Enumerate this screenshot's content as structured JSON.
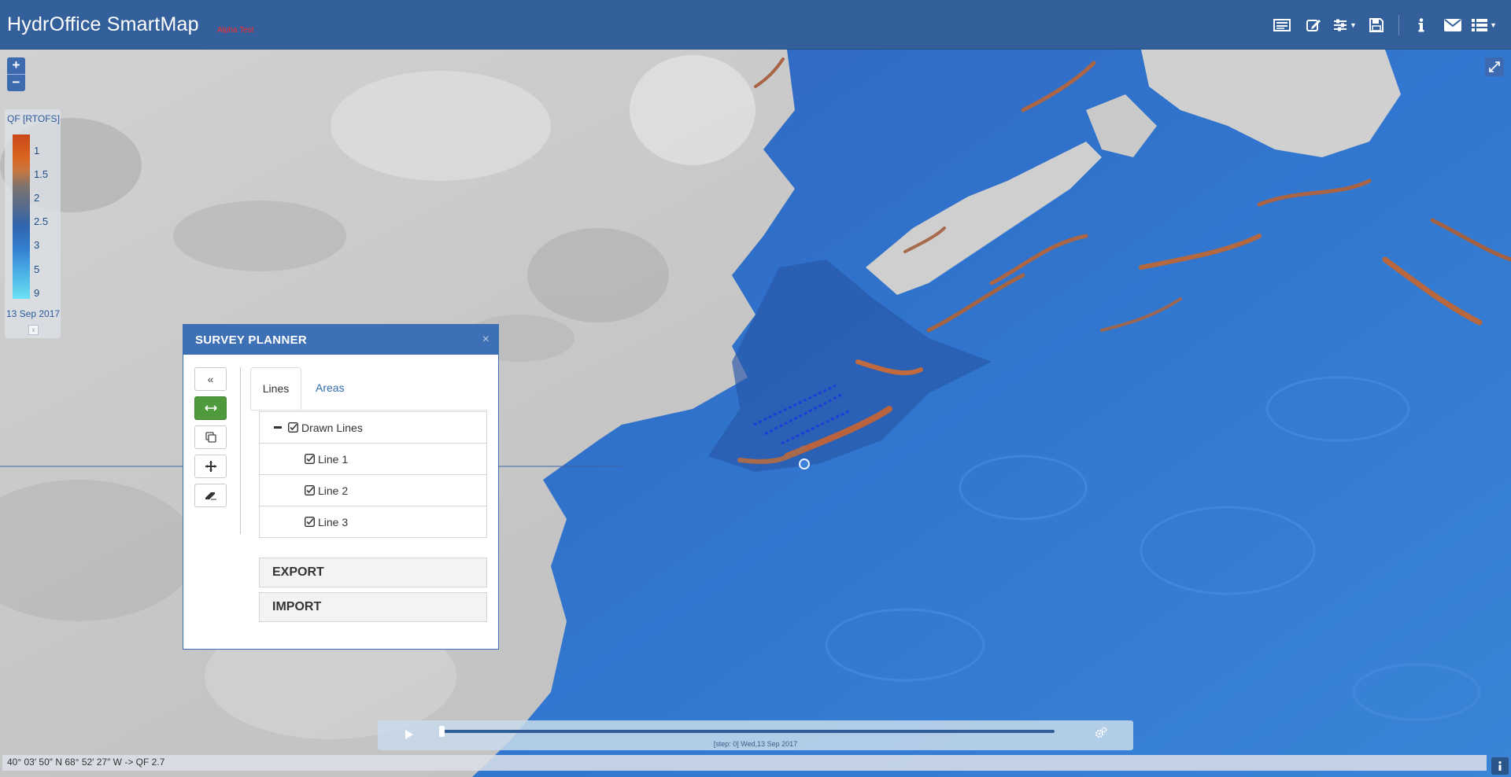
{
  "header": {
    "title": "HydrOffice SmartMap",
    "tag": "Alpha Test",
    "icons": [
      "table-icon",
      "edit-icon",
      "sliders-icon",
      "save-icon",
      "info-icon",
      "envelope-icon",
      "list-icon"
    ]
  },
  "zoom": {
    "in_label": "+",
    "out_label": "−"
  },
  "legend": {
    "title": "QF [RTOFS]",
    "labels": [
      "1",
      "1.5",
      "2",
      "2.5",
      "3",
      "5",
      "9"
    ],
    "date": "13 Sep 2017",
    "close_label": "x",
    "colors": [
      "#c9471a",
      "#d9651e",
      "#7a7370",
      "#2f64aa",
      "#3580d2",
      "#4eb6e7",
      "#6ce1f4"
    ]
  },
  "planner": {
    "title": "SURVEY PLANNER",
    "close_label": "×",
    "tools": [
      "collapse-icon",
      "draw-line-icon",
      "copy-icon",
      "move-icon",
      "eraser-icon"
    ],
    "tabs": {
      "lines": "Lines",
      "areas": "Areas"
    },
    "tree": {
      "root": "Drawn Lines",
      "items": [
        "Line 1",
        "Line 2",
        "Line 3"
      ]
    },
    "export_label": "EXPORT",
    "import_label": "IMPORT",
    "accent": "#3d70b4",
    "active_tool_color": "#4e9a3c"
  },
  "timeline": {
    "label": "[step: 0] Wed,13 Sep 2017",
    "progress": 0
  },
  "status": {
    "coords": "40° 03′ 50″ N 68° 52′ 27″ W -> QF 2.7"
  }
}
